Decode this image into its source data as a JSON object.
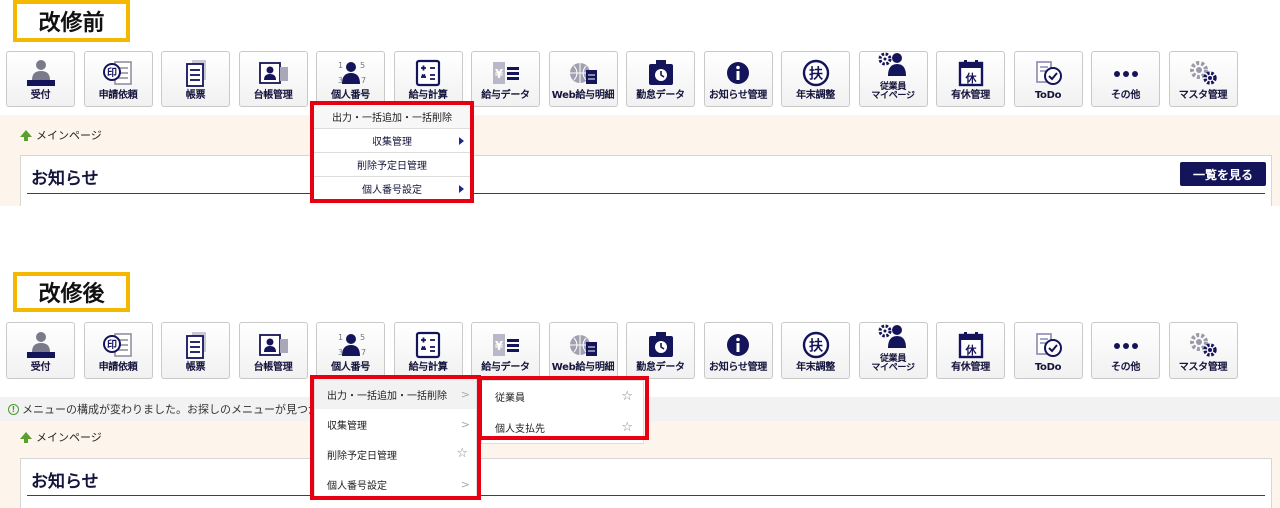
{
  "before": {
    "tag": "改修前",
    "toolbar": [
      {
        "label": "受付",
        "icon": "reception-person-icon"
      },
      {
        "label": "申請依頼",
        "icon": "stamp-document-icon"
      },
      {
        "label": "帳票",
        "icon": "documents-icon"
      },
      {
        "label": "台帳管理",
        "icon": "id-card-icon"
      },
      {
        "label": "個人番号",
        "icon": "person-number-icon"
      },
      {
        "label": "給与計算",
        "icon": "calculator-icon"
      },
      {
        "label": "給与データ",
        "icon": "yen-list-icon"
      },
      {
        "label": "Web給与明細",
        "icon": "globe-document-icon"
      },
      {
        "label": "勤怠データ",
        "icon": "time-card-icon"
      },
      {
        "label": "お知らせ管理",
        "icon": "info-icon"
      },
      {
        "label": "年末調整",
        "icon": "fuyou-icon"
      },
      {
        "label": "従業員\nマイページ",
        "icon": "employee-gear-icon"
      },
      {
        "label": "有休管理",
        "icon": "holiday-calendar-icon"
      },
      {
        "label": "ToDo",
        "icon": "todo-check-icon"
      },
      {
        "label": "その他",
        "icon": "more-dots-icon"
      },
      {
        "label": "マスタ管理",
        "icon": "gears-icon"
      }
    ],
    "breadcrumb": "メインページ",
    "panel_title": "お知らせ",
    "list_button": "一覧を見る",
    "menu": [
      "出力・一括追加・一括削除",
      "収集管理",
      "削除予定日管理",
      "個人番号設定"
    ]
  },
  "after": {
    "tag": "改修後",
    "toolbar": [
      {
        "label": "受付",
        "icon": "reception-person-icon"
      },
      {
        "label": "申請依頼",
        "icon": "stamp-document-icon"
      },
      {
        "label": "帳票",
        "icon": "documents-icon"
      },
      {
        "label": "台帳管理",
        "icon": "id-card-icon"
      },
      {
        "label": "個人番号",
        "icon": "person-number-icon"
      },
      {
        "label": "給与計算",
        "icon": "calculator-icon"
      },
      {
        "label": "給与データ",
        "icon": "yen-list-icon"
      },
      {
        "label": "Web給与明細",
        "icon": "globe-document-icon"
      },
      {
        "label": "勤怠データ",
        "icon": "time-card-icon"
      },
      {
        "label": "お知らせ管理",
        "icon": "info-icon"
      },
      {
        "label": "年末調整",
        "icon": "fuyou-icon"
      },
      {
        "label": "従業員\nマイページ",
        "icon": "employee-gear-icon"
      },
      {
        "label": "有休管理",
        "icon": "holiday-calendar-icon"
      },
      {
        "label": "ToDo",
        "icon": "todo-check-icon"
      },
      {
        "label": "その他",
        "icon": "more-dots-icon"
      },
      {
        "label": "マスタ管理",
        "icon": "gears-icon"
      }
    ],
    "notice": "メニューの構成が変わりました。お探しのメニューが見つか",
    "breadcrumb": "メインページ",
    "panel_title": "お知らせ",
    "menu": [
      "出力・一括追加・一括削除",
      "収集管理",
      "削除予定日管理",
      "個人番号設定"
    ],
    "submenu": [
      "従業員",
      "個人支払先"
    ],
    "star": "☆",
    "chevron": ">"
  },
  "icon_glyphs": {
    "fuyou": "扶",
    "holiday": "休",
    "person_number_digits": "1 5 3 7",
    "stamp": "印",
    "yen": "¥"
  },
  "colors": {
    "navy": "#14145a",
    "accent_red": "#e60012",
    "tag_border": "#f5b800",
    "crumb_green": "#5aa02c"
  }
}
